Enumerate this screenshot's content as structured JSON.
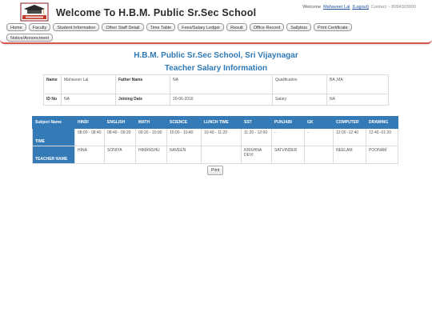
{
  "header": {
    "site_title": "Welcome To H.B.M. Public Sr.Sec School",
    "welcome": "Welcome",
    "user": "Mahaveer Lal",
    "logout": "(Logout)",
    "contact": "Contact :- 8094303000"
  },
  "nav": [
    "Home",
    "Faculty",
    "Student Information",
    "Other Staff Detail",
    "Time Table",
    "Fees/Salary Ledger",
    "Result",
    "Office Record",
    "Sallybus",
    "Print Certificate",
    "Notice/Annoncment"
  ],
  "school_heading": "H.B.M. Public Sr.Sec School, Sri Vijaynagar",
  "page_heading": "Teacher Salary Information",
  "info": {
    "name_label": "Name",
    "name": "Mahaveer Lal",
    "father_label": "Father Name",
    "father": "NA",
    "qual_label": "Qualification",
    "qual": "BA ,MA",
    "id_label": "ID No",
    "id": "NA",
    "join_label": "Joining Date",
    "join": "20-06-2016",
    "salary_label": "Salary",
    "salary": "NA"
  },
  "schedule": {
    "subject_label": "Subject Name",
    "time_label": "TIME",
    "teacher_label": "TEACHER NAME",
    "columns": [
      {
        "subject": "HINDI",
        "time": "08:00 - 08:40",
        "teacher": "HINA"
      },
      {
        "subject": "ENGLISH",
        "time": "08:40 - 09:20",
        "teacher": "SONIYA"
      },
      {
        "subject": "MATH",
        "time": "09:20 - 10:00",
        "teacher": "HIMANSHU"
      },
      {
        "subject": "SCIENCE",
        "time": "10:00 - 10:40",
        "teacher": "NAVEEN"
      },
      {
        "subject": "LUNCH TIME",
        "time": "10:40 - 11:20",
        "teacher": ""
      },
      {
        "subject": "SST",
        "time": "11:20 - 12:00",
        "teacher": "KRISHNA DEVI"
      },
      {
        "subject": "PUNJABI",
        "time": "-",
        "teacher": "SATVINDER"
      },
      {
        "subject": "GK",
        "time": "-",
        "teacher": ""
      },
      {
        "subject": "COMPUTER",
        "time": "12:00 -12:40",
        "teacher": "NEELAM"
      },
      {
        "subject": "DRAWING",
        "time": "12:40 -01:20",
        "teacher": "POONAM"
      }
    ]
  },
  "print_label": "Print",
  "colors": {
    "accent": "#337ab7",
    "header_border": "#d9534f"
  }
}
